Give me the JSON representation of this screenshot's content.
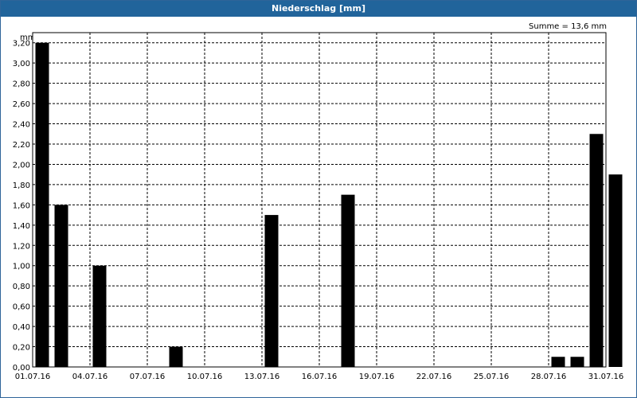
{
  "title": "Niederschlag [mm]",
  "summary": "Summe = 13,6 mm",
  "chart_data": {
    "type": "bar",
    "title": "Niederschlag [mm]",
    "ylabel": "mm",
    "ylim": [
      0,
      3.3
    ],
    "y_ticks": [
      "0,00",
      "0,20",
      "0,40",
      "0,60",
      "0,80",
      "1,00",
      "1,20",
      "1,40",
      "1,60",
      "1,80",
      "2,00",
      "2,20",
      "2,40",
      "2,60",
      "2,80",
      "3,00",
      "3,20"
    ],
    "x_ticks": [
      "01.07.16",
      "04.07.16",
      "07.07.16",
      "10.07.16",
      "13.07.16",
      "16.07.16",
      "19.07.16",
      "22.07.16",
      "25.07.16",
      "28.07.16",
      "31.07.16"
    ],
    "categories": [
      "01.07.16",
      "02.07.16",
      "03.07.16",
      "04.07.16",
      "05.07.16",
      "06.07.16",
      "07.07.16",
      "08.07.16",
      "09.07.16",
      "10.07.16",
      "11.07.16",
      "12.07.16",
      "13.07.16",
      "14.07.16",
      "15.07.16",
      "16.07.16",
      "17.07.16",
      "18.07.16",
      "19.07.16",
      "20.07.16",
      "21.07.16",
      "22.07.16",
      "23.07.16",
      "24.07.16",
      "25.07.16",
      "26.07.16",
      "27.07.16",
      "28.07.16",
      "29.07.16",
      "30.07.16",
      "31.07.16"
    ],
    "values": [
      0,
      3.2,
      1.6,
      0,
      1.0,
      0,
      0,
      0,
      0.2,
      0,
      0,
      0,
      0,
      1.5,
      0,
      0,
      0,
      1.7,
      0,
      0,
      0,
      0,
      0,
      0,
      0,
      0,
      0,
      0,
      0.1,
      0.1,
      2.3,
      1.9
    ],
    "grid": true,
    "bar_color": "#000000"
  }
}
